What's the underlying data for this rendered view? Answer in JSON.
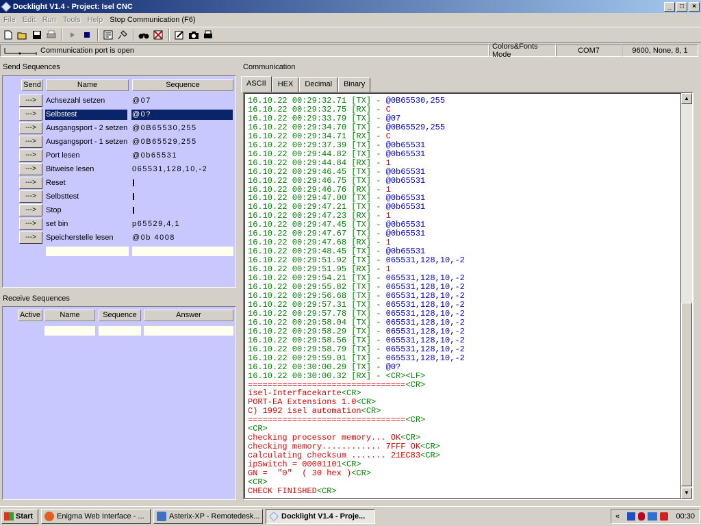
{
  "window": {
    "title": "Docklight V1.4 - Project: Isel CNC"
  },
  "menu": {
    "items": [
      {
        "label": "File",
        "enabled": false
      },
      {
        "label": "Edit",
        "enabled": false
      },
      {
        "label": "Run",
        "enabled": false
      },
      {
        "label": "Tools",
        "enabled": false
      },
      {
        "label": "Help",
        "enabled": false
      },
      {
        "label": "Stop Communication  (F6)",
        "enabled": true
      }
    ]
  },
  "status": {
    "port_text": "Communication port is open",
    "mode": "Colors&Fonts Mode",
    "com": "COM7",
    "settings": "9600, None, 8, 1"
  },
  "send": {
    "title": "Send Sequences",
    "headers": {
      "send": "Send",
      "name": "Name",
      "sequence": "Sequence"
    },
    "button_label": "--->",
    "rows": [
      {
        "name": "Achsezahl setzen",
        "seq": "@07"
      },
      {
        "name": "Selbstest",
        "seq": "@0?"
      },
      {
        "name": "Ausgangsport - 2 setzen",
        "seq": "@0B65530,255"
      },
      {
        "name": "Ausgangsport - 1 setzen",
        "seq": "@0B65529,255"
      },
      {
        "name": "Port lesen",
        "seq": "@0b65531"
      },
      {
        "name": "Bitweise lesen",
        "seq": "065531,128,10,-2"
      },
      {
        "name": "Reset",
        "seq": ""
      },
      {
        "name": "Selbsttest",
        "seq": ""
      },
      {
        "name": "Stop",
        "seq": ""
      },
      {
        "name": "set bin",
        "seq": "p65529,4,1"
      },
      {
        "name": "Speicherstelle lesen",
        "seq": "@0b 4008"
      }
    ]
  },
  "receive": {
    "title": "Receive Sequences",
    "headers": {
      "active": "Active",
      "name": "Name",
      "sequence": "Sequence",
      "answer": "Answer"
    }
  },
  "communication": {
    "title": "Communication",
    "tabs": [
      "ASCII",
      "HEX",
      "Decimal",
      "Binary"
    ],
    "log": [
      {
        "t": "16.10.22 00:29:32.71",
        "d": "[TX]",
        "v": "@0B65530,255"
      },
      {
        "t": "16.10.22 00:29:32.75",
        "d": "[RX]",
        "v": "C"
      },
      {
        "t": "16.10.22 00:29:33.79",
        "d": "[TX]",
        "v": "@07"
      },
      {
        "t": "16.10.22 00:29:34.70",
        "d": "[TX]",
        "v": "@0B65529,255"
      },
      {
        "t": "16.10.22 00:29:34.71",
        "d": "[RX]",
        "v": "C"
      },
      {
        "t": "16.10.22 00:29:37.39",
        "d": "[TX]",
        "v": "@0b65531"
      },
      {
        "t": "16.10.22 00:29:44.82",
        "d": "[TX]",
        "v": "@0b65531"
      },
      {
        "t": "16.10.22 00:29:44.84",
        "d": "[RX]",
        "v": "1"
      },
      {
        "t": "16.10.22 00:29:46.45",
        "d": "[TX]",
        "v": "@0b65531"
      },
      {
        "t": "16.10.22 00:29:46.75",
        "d": "[TX]",
        "v": "@0b65531"
      },
      {
        "t": "16.10.22 00:29:46.76",
        "d": "[RX]",
        "v": "1"
      },
      {
        "t": "16.10.22 00:29:47.00",
        "d": "[TX]",
        "v": "@0b65531"
      },
      {
        "t": "16.10.22 00:29:47.21",
        "d": "[TX]",
        "v": "@0b65531"
      },
      {
        "t": "16.10.22 00:29:47.23",
        "d": "[RX]",
        "v": "1"
      },
      {
        "t": "16.10.22 00:29:47.45",
        "d": "[TX]",
        "v": "@0b65531"
      },
      {
        "t": "16.10.22 00:29:47.67",
        "d": "[TX]",
        "v": "@0b65531"
      },
      {
        "t": "16.10.22 00:29:47.68",
        "d": "[RX]",
        "v": "1"
      },
      {
        "t": "16.10.22 00:29:48.45",
        "d": "[TX]",
        "v": "@0b65531"
      },
      {
        "t": "16.10.22 00:29:51.92",
        "d": "[TX]",
        "v": "065531,128,10,-2"
      },
      {
        "t": "16.10.22 00:29:51.95",
        "d": "[RX]",
        "v": "1"
      },
      {
        "t": "16.10.22 00:29:54.21",
        "d": "[TX]",
        "v": "065531,128,10,-2"
      },
      {
        "t": "16.10.22 00:29:55.82",
        "d": "[TX]",
        "v": "065531,128,10,-2"
      },
      {
        "t": "16.10.22 00:29:56.68",
        "d": "[TX]",
        "v": "065531,128,10,-2"
      },
      {
        "t": "16.10.22 00:29:57.31",
        "d": "[TX]",
        "v": "065531,128,10,-2"
      },
      {
        "t": "16.10.22 00:29:57.78",
        "d": "[TX]",
        "v": "065531,128,10,-2"
      },
      {
        "t": "16.10.22 00:29:58.04",
        "d": "[TX]",
        "v": "065531,128,10,-2"
      },
      {
        "t": "16.10.22 00:29:58.29",
        "d": "[TX]",
        "v": "065531,128,10,-2"
      },
      {
        "t": "16.10.22 00:29:58.56",
        "d": "[TX]",
        "v": "065531,128,10,-2"
      },
      {
        "t": "16.10.22 00:29:58.79",
        "d": "[TX]",
        "v": "065531,128,10,-2"
      },
      {
        "t": "16.10.22 00:29:59.01",
        "d": "[TX]",
        "v": "065531,128,10,-2"
      },
      {
        "t": "16.10.22 00:30:00.29",
        "d": "[TX]",
        "v": "@0?"
      },
      {
        "t": "16.10.22 00:30:00.32",
        "d": "[RX]",
        "v": "<CR><LF>"
      }
    ],
    "response": [
      {
        "text": "================================",
        "tag": "<CR>"
      },
      {
        "text": "isel-Interfacekarte",
        "tag": "<CR>"
      },
      {
        "text": "PORT-EA Extensions 1.0",
        "tag": "<CR>"
      },
      {
        "text": "C) 1992 isel automation",
        "tag": "<CR>"
      },
      {
        "text": "================================",
        "tag": "<CR>"
      },
      {
        "text": "",
        "tag": "<CR>"
      },
      {
        "text": "checking processor memory... OK",
        "tag": "<CR>"
      },
      {
        "text": "checking memory............ 7FFF OK",
        "tag": "<CR>"
      },
      {
        "text": "calculating checksum ....... 21EC83",
        "tag": "<CR>"
      },
      {
        "text": "ipSwitch = 00001101",
        "tag": "<CR>"
      },
      {
        "text": "GN =  \"0\"  ( 30 hex )",
        "tag": "<CR>"
      },
      {
        "text": "",
        "tag": "<CR>"
      },
      {
        "text": "CHECK FINISHED",
        "tag": "<CR>"
      }
    ]
  },
  "taskbar": {
    "start": "Start",
    "tasks": [
      {
        "label": "Enigma Web Interface - ...",
        "active": false
      },
      {
        "label": "Asterix-XP - Remotedesk...",
        "active": false
      },
      {
        "label": "Docklight V1.4 - Proje...",
        "active": true
      }
    ],
    "tray_chevron": "«",
    "clock": "00:30"
  }
}
